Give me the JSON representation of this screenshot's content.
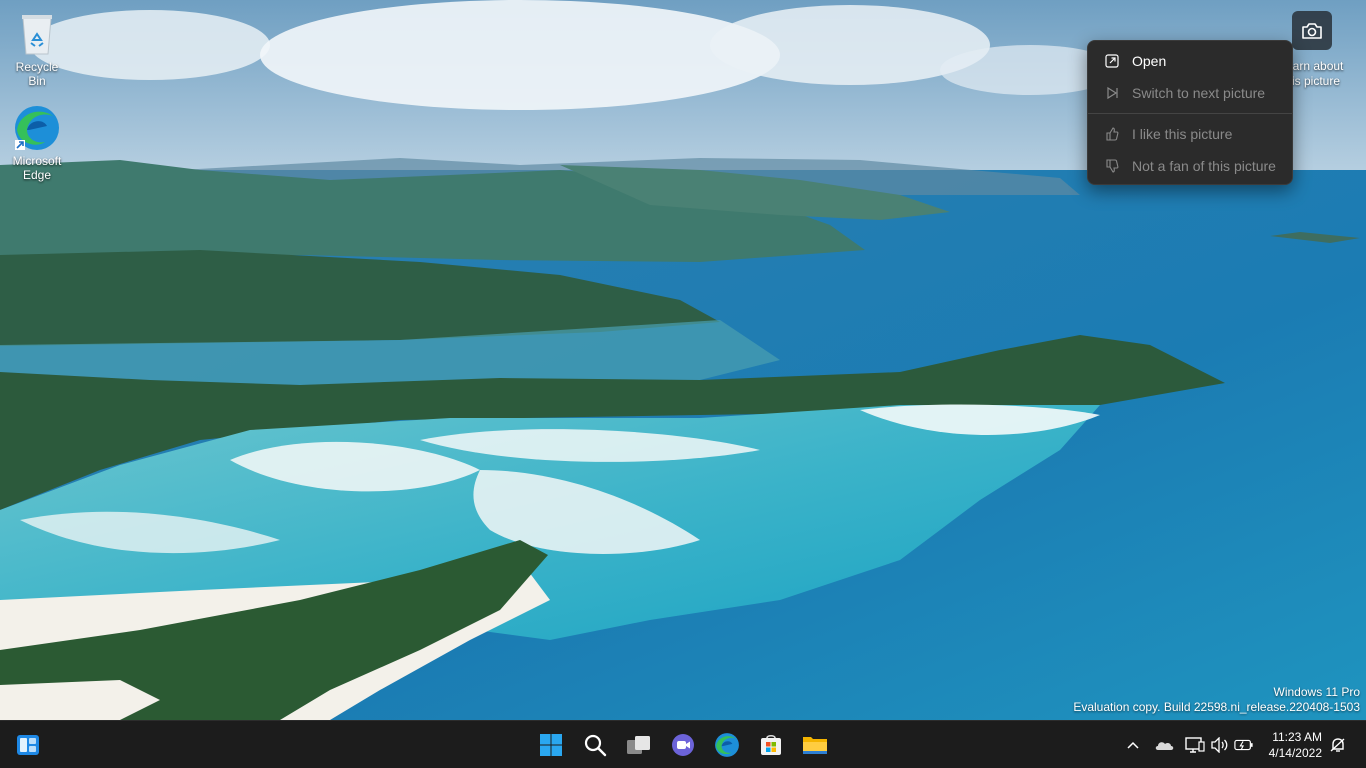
{
  "desktop": {
    "icons": [
      {
        "label": "Recycle Bin",
        "icon": "recycle-bin-icon"
      },
      {
        "label": "Microsoft Edge",
        "icon": "edge-icon"
      }
    ],
    "spotlight": {
      "button_icon": "camera-icon",
      "learn_line1": "earn about",
      "learn_line2": "is picture"
    }
  },
  "context_menu": {
    "items": [
      {
        "label": "Open",
        "icon": "open-external-icon",
        "enabled": true
      },
      {
        "label": "Switch to next picture",
        "icon": "next-picture-icon",
        "enabled": false
      },
      {
        "label": "I like this picture",
        "icon": "thumbs-up-icon",
        "enabled": false
      },
      {
        "label": "Not a fan of this picture",
        "icon": "thumbs-down-icon",
        "enabled": false
      }
    ]
  },
  "watermark": {
    "line1": "Windows 11 Pro",
    "line2": "Evaluation copy. Build 22598.ni_release.220408-1503"
  },
  "taskbar": {
    "pinned": [
      "start-icon",
      "search-icon",
      "task-view-icon",
      "teams-chat-icon",
      "edge-icon",
      "store-icon",
      "file-explorer-icon"
    ],
    "tray": [
      "chevron-up-icon",
      "onedrive-icon",
      "network-icon",
      "volume-icon",
      "battery-icon"
    ],
    "time": "11:23 AM",
    "date": "4/14/2022",
    "notification_icon": "notification-bell-icon"
  },
  "colors": {
    "taskbar_bg": "#1c1c1c",
    "menu_bg": "#2b2b2b",
    "accent": "#0078d4"
  }
}
